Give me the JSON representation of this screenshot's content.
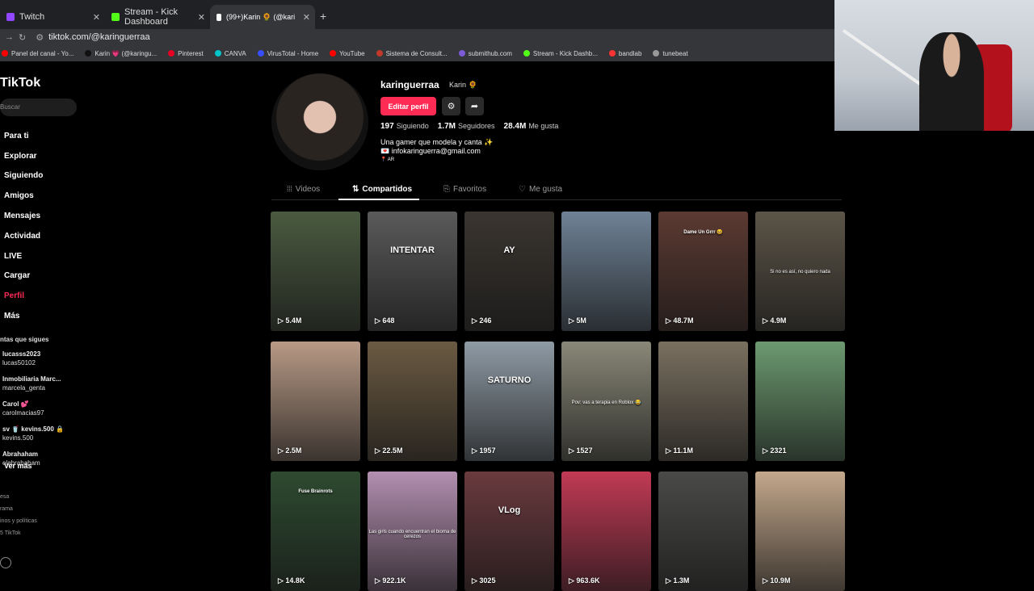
{
  "browser": {
    "tabs": [
      {
        "label": "Twitch",
        "color": "#9146ff"
      },
      {
        "label": "Stream - Kick Dashboard",
        "color": "#53fc18"
      },
      {
        "label": "(99+)Karin 🌻 (@karinguerraa)",
        "color": "#111111"
      }
    ],
    "url": "tiktok.com/@karinguerraa",
    "bookmarks": [
      {
        "label": "Panel del canal - Yo...",
        "color": "#ff0000"
      },
      {
        "label": "Karin 💗 (@karingu...",
        "color": "#111111"
      },
      {
        "label": "Pinterest",
        "color": "#e60023"
      },
      {
        "label": "CANVA",
        "color": "#00c4cc"
      },
      {
        "label": "VirusTotal - Home",
        "color": "#394eff"
      },
      {
        "label": "YouTube",
        "color": "#ff0000"
      },
      {
        "label": "Sistema de Consult...",
        "color": "#c0392b"
      },
      {
        "label": "submithub.com",
        "color": "#7b5cd6"
      },
      {
        "label": "Stream - Kick Dashb...",
        "color": "#53fc18"
      },
      {
        "label": "bandlab",
        "color": "#f33"
      },
      {
        "label": "tunebeat",
        "color": "#999999"
      }
    ]
  },
  "sidebar": {
    "logo": "TikTok",
    "search_placeholder": "Buscar",
    "nav": [
      "Para ti",
      "Explorar",
      "Siguiendo",
      "Amigos",
      "Mensajes",
      "Actividad",
      "LIVE",
      "Cargar",
      "Perfil",
      "Más"
    ],
    "active_index": 8,
    "following_title": "ntas que sigues",
    "following": [
      {
        "name": "lucasss2023",
        "user": "lucas50102"
      },
      {
        "name": "Inmobiliaria Marc...",
        "user": "marcela_genta"
      },
      {
        "name": "Carol 💕",
        "user": "carolmacias97"
      },
      {
        "name": "sv 🥤 kevins.500 🔒",
        "user": "kevins.500"
      },
      {
        "name": "Abrahaham",
        "user": "elabrahaham"
      }
    ],
    "see_more": "Ver más",
    "footer": [
      "esa",
      "rama",
      "inos y políticas",
      "5 TikTok"
    ]
  },
  "profile": {
    "username": "karinguerraa",
    "display_name": "Karin 🌻",
    "edit_button": "Editar perfil",
    "following_count": "197",
    "following_label": "Siguiendo",
    "followers_count": "1.7M",
    "followers_label": "Seguidores",
    "likes_count": "28.4M",
    "likes_label": "Me gusta",
    "bio_line1": "Una gamer que modela y canta ✨",
    "bio_line2": "💌 infokaringuerra@gmail.com",
    "bio_line3": "📍 AR"
  },
  "tabs": {
    "videos": "Videos",
    "shared": "Compartidos",
    "favorites": "Favoritos",
    "likes": "Me gusta"
  },
  "grid": [
    {
      "views": "5.4M",
      "caption": "",
      "bg": "#4a5a40"
    },
    {
      "views": "648",
      "caption": "INTENTAR",
      "bg": "#5a5a5a"
    },
    {
      "views": "246",
      "caption": "AY",
      "bg": "#3a3530"
    },
    {
      "views": "5M",
      "caption": "",
      "bg": "#6f8296"
    },
    {
      "views": "48.7M",
      "caption": "Dame Un Grrr 😆",
      "bg": "#5b3a32"
    },
    {
      "views": "4.9M",
      "caption": "Si no es así, no quiero nada",
      "bg": "#5c5548"
    },
    {
      "views": "2.5M",
      "caption": "",
      "bg": "#b89a86"
    },
    {
      "views": "22.5M",
      "caption": "",
      "bg": "#6b5a42"
    },
    {
      "views": "1957",
      "caption": "SATURNO",
      "bg": "#8e9aa4"
    },
    {
      "views": "1527",
      "caption": "Pov: vas a terapia en Roblox 😂",
      "bg": "#8a8878"
    },
    {
      "views": "11.1M",
      "caption": "",
      "bg": "#7a7060"
    },
    {
      "views": "2321",
      "caption": "",
      "bg": "#6c9a70"
    },
    {
      "views": "14.8K",
      "caption": "Fuse Brainrots",
      "bg": "#2e4a30"
    },
    {
      "views": "922.1K",
      "caption": "Las girls cuando encuentran el bioma de cerezos",
      "bg": "#b38fb0"
    },
    {
      "views": "3025",
      "caption": "VLog",
      "bg": "#6a3a3e"
    },
    {
      "views": "963.6K",
      "caption": "",
      "bg": "#c23a55"
    },
    {
      "views": "1.3M",
      "caption": "",
      "bg": "#4a4a48"
    },
    {
      "views": "10.9M",
      "caption": "",
      "bg": "#c4a88c"
    }
  ]
}
